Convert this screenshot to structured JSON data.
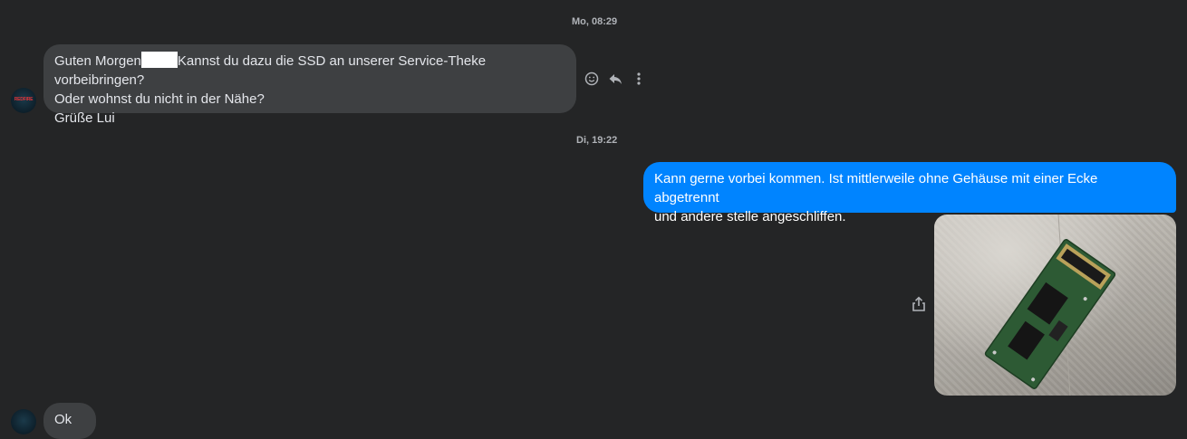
{
  "timestamps": [
    "Mo, 08:29",
    "Di, 19:22"
  ],
  "incoming_message": {
    "line1_start": "Guten Morgen",
    "line1_end": "Kannst du dazu die SSD an unserer Service-Theke vorbeibringen?",
    "line2": "Oder wohnst du nicht in der Nähe?",
    "line3": "Grüße Lui"
  },
  "avatar_text": "REDFIRE",
  "outgoing_message": {
    "line1": "Kann gerne vorbei kommen. Ist mittlerweile ohne Gehäuse mit einer Ecke abgetrennt",
    "line2": "und andere stelle angeschliffen."
  },
  "partial_message": "Ok",
  "icons": [
    "smiley-icon",
    "reply-icon",
    "more-options-icon",
    "share-icon"
  ],
  "colors": {
    "background": "#242526",
    "incoming_bubble": "#3e4042",
    "outgoing_bubble": "#0084ff"
  }
}
